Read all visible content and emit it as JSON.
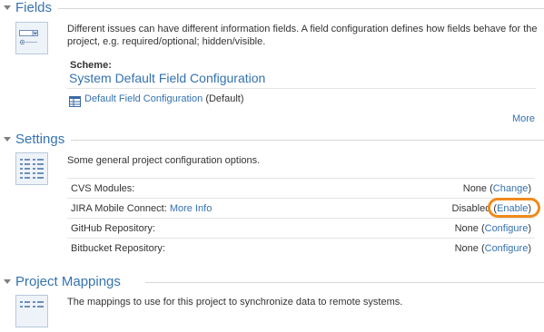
{
  "fields": {
    "title": "Fields",
    "description_line1": "Different issues can have different information fields. A field configuration defines how fields behave for the",
    "description_line2": "project, e.g. required/optional; hidden/visible.",
    "scheme_label": "Scheme:",
    "scheme_name": "System Default Field Configuration",
    "config_link": "Default Field Configuration",
    "config_suffix": "(Default)",
    "more": "More"
  },
  "settings": {
    "title": "Settings",
    "description": "Some general project configuration options.",
    "rows": [
      {
        "label": "CVS Modules:",
        "value": "None",
        "action": "Change"
      },
      {
        "label_prefix": "JIRA Mobile Connect:",
        "label_link": "More Info",
        "value": "Disabled",
        "action": "Enable"
      },
      {
        "label": "GitHub Repository:",
        "value": "None",
        "action": "Configure"
      },
      {
        "label": "Bitbucket Repository:",
        "value": "None",
        "action": "Configure"
      }
    ]
  },
  "project_mappings": {
    "title": "Project Mappings",
    "description": "The mappings to use for this project to synchronize data to remote systems."
  },
  "colors": {
    "link": "#3572b0",
    "callout": "#f08a1c",
    "separator": "#e4e4e4"
  }
}
